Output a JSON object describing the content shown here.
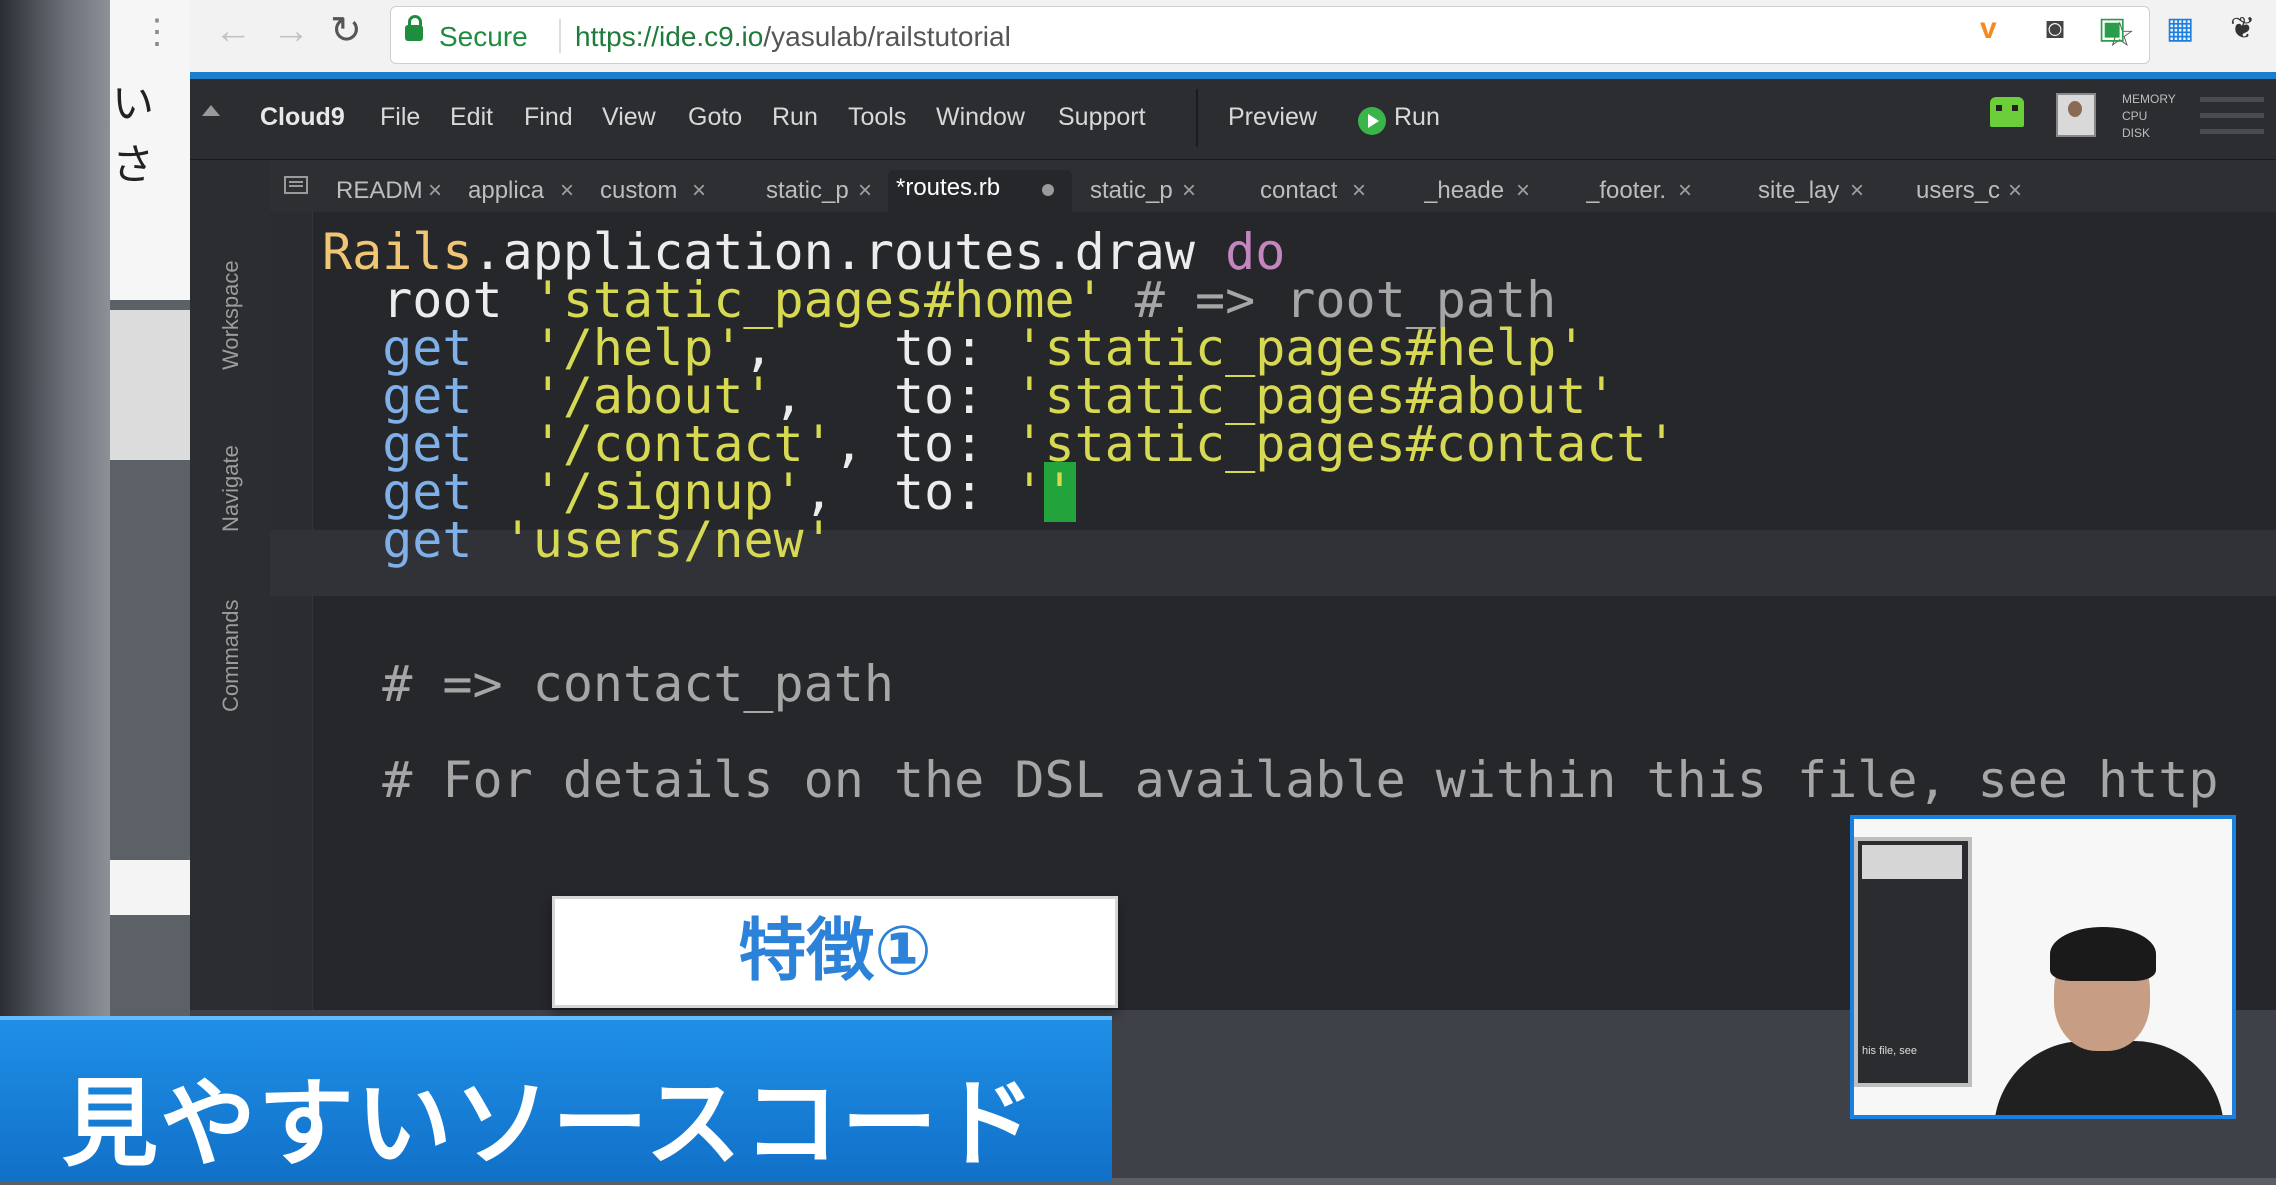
{
  "browser": {
    "secure_label": "Secure",
    "url_host": "https://ide.c9.io",
    "url_path": "/yasulab/railstutorial"
  },
  "menu": {
    "brand": "Cloud9",
    "items": [
      "File",
      "Edit",
      "Find",
      "View",
      "Goto",
      "Run",
      "Tools",
      "Window",
      "Support"
    ],
    "preview": "Preview",
    "run": "Run",
    "stats": [
      "MEMORY",
      "CPU",
      "DISK"
    ]
  },
  "sidebar": [
    "Workspace",
    "Navigate",
    "Commands"
  ],
  "tabs": [
    {
      "label": "READM",
      "close": "×"
    },
    {
      "label": "applica",
      "close": "×"
    },
    {
      "label": "custom",
      "close": "×"
    },
    {
      "label": "static_p",
      "close": "×"
    },
    {
      "label": "*routes.rb",
      "active": true
    },
    {
      "label": "static_p",
      "close": "×"
    },
    {
      "label": "contact",
      "close": "×"
    },
    {
      "label": "_heade",
      "close": "×"
    },
    {
      "label": "_footer.",
      "close": "×"
    },
    {
      "label": "site_lay",
      "close": "×"
    },
    {
      "label": "users_c",
      "close": "×"
    }
  ],
  "code": {
    "line1": {
      "const": "Rails",
      "rest": ".application.routes.draw ",
      "kw": "do"
    },
    "line2": {
      "a": "  root ",
      "b": "'static_pages#home'",
      "c": " # => root_path"
    },
    "line3": {
      "a": "  get",
      "b": "  '/help'",
      "c": ",    to: ",
      "d": "'static_pages#help'"
    },
    "line4": {
      "a": "  get",
      "b": "  '/about'",
      "c": ",   to: ",
      "d": "'static_pages#about'"
    },
    "line5": {
      "a": "  get",
      "b": "  '/contact'",
      "c": ", to: ",
      "d": "'static_pages#contact'"
    },
    "line6": {
      "a": "  get",
      "b": "  '/signup'",
      "c": ",  to: ",
      "d": "'",
      "e": "'"
    },
    "line7": {
      "a": "  get",
      "b": " 'users/new'"
    },
    "line8": {
      "a": "  # => contact_path"
    },
    "line9": {
      "a": "  # For details on the DSL available within this file, see http"
    },
    "line10": {
      "a": "        "
    }
  },
  "overlay": {
    "feature_label": "特徴①",
    "banner": "見やすいソースコード",
    "pip_caption": "his file, see"
  },
  "colors": {
    "accent": "#1b7fcc",
    "banner": "#1a84dc"
  }
}
